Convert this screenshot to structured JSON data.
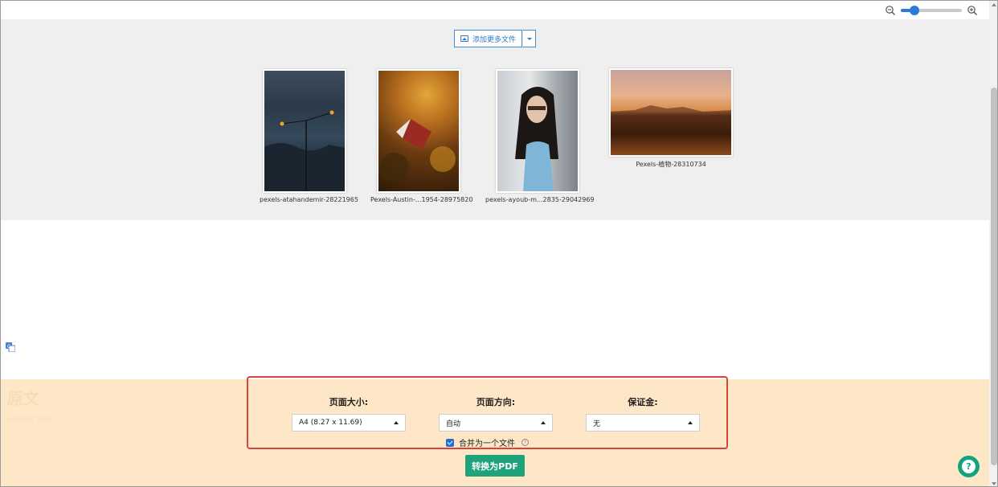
{
  "zoom": {
    "level": 0.22
  },
  "gallery": {
    "add_button_label": "添加更多文件",
    "images": [
      {
        "caption": "pexels-atahandemir-28221965"
      },
      {
        "caption": "Pexels-Austin-...1954-28975820"
      },
      {
        "caption": "pexels-ayoub-m...2835-29042969"
      },
      {
        "caption": "Pexels-植物-28310734"
      }
    ]
  },
  "background": {
    "title": "原文",
    "subtitle": "source text"
  },
  "options": {
    "page_size": {
      "label": "页面大小:",
      "value": "A4 (8.27 x 11.69)"
    },
    "orientation": {
      "label": "页面方向:",
      "value": "自动"
    },
    "margin": {
      "label": "保证金:",
      "value": "无"
    },
    "merge": {
      "label": "合并为一个文件",
      "checked": true,
      "help": "?"
    }
  },
  "convert_button_label": "转换为PDF",
  "chat": {
    "symbol": "?"
  },
  "colors": {
    "accent": "#2b79c9",
    "convert": "#1ea37a",
    "highlight_border": "#d9443a",
    "peach": "#fde7c7"
  }
}
